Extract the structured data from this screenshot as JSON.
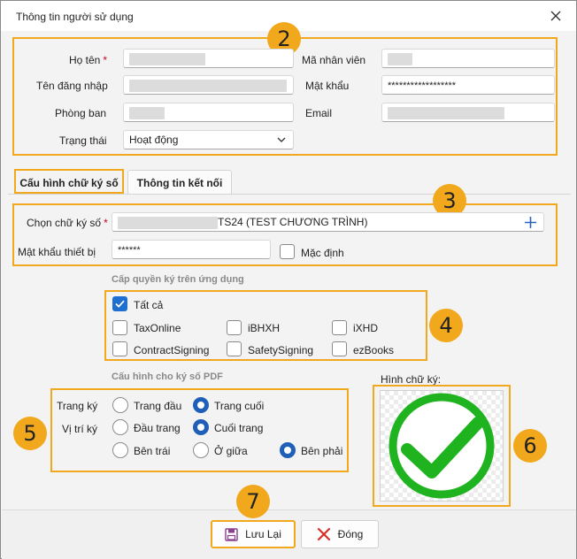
{
  "window": {
    "title": "Thông tin người sử dụng"
  },
  "user": {
    "fullname_label": "Họ tên",
    "required_mark": "*",
    "employee_code_label": "Mã nhân viên",
    "username_label": "Tên đăng nhập",
    "password_label": "Mật khẩu",
    "password_value": "******************",
    "department_label": "Phòng ban",
    "email_label": "Email",
    "status_label": "Trạng thái",
    "status_value": "Hoạt động"
  },
  "tabs": [
    {
      "label": "Cấu hình chữ ký số",
      "active": true
    },
    {
      "label": "Thông tin kết nối",
      "active": false
    }
  ],
  "signature": {
    "select_label": "Chọn chữ ký số",
    "required_mark": "*",
    "select_value": "TS24 (TEST CHƯƠNG TRÌNH)",
    "device_password_label": "Mật khẩu thiết bị",
    "device_password_value": "******",
    "default_label": "Mặc định"
  },
  "permissions": {
    "section_title": "Cấp quyền ký trên ứng dụng",
    "all_label": "Tất cả",
    "apps": [
      "TaxOnline",
      "iBHXH",
      "iXHD",
      "ContractSigning",
      "SafetySigning",
      "ezBooks"
    ]
  },
  "pdf": {
    "section_title": "Cấu hình cho ký số PDF",
    "page_label": "Trang ký",
    "page_options": [
      "Trang đầu",
      "Trang cuối"
    ],
    "position_label": "Vị trí ký",
    "position_options": [
      "Đầu trang",
      "Cuối trang",
      "Bên trái",
      "Ở giữa",
      "Bên phải"
    ]
  },
  "signature_image": {
    "label": "Hình chữ ký:"
  },
  "badges": [
    "2",
    "3",
    "4",
    "5",
    "6",
    "7"
  ],
  "buttons": {
    "save_label": "Lưu Lại",
    "close_label": "Đóng"
  },
  "colors": {
    "accent": "#f2a81d",
    "primary": "#1f6fd0",
    "check_green": "#1fb31f",
    "close_red": "#d93025"
  }
}
